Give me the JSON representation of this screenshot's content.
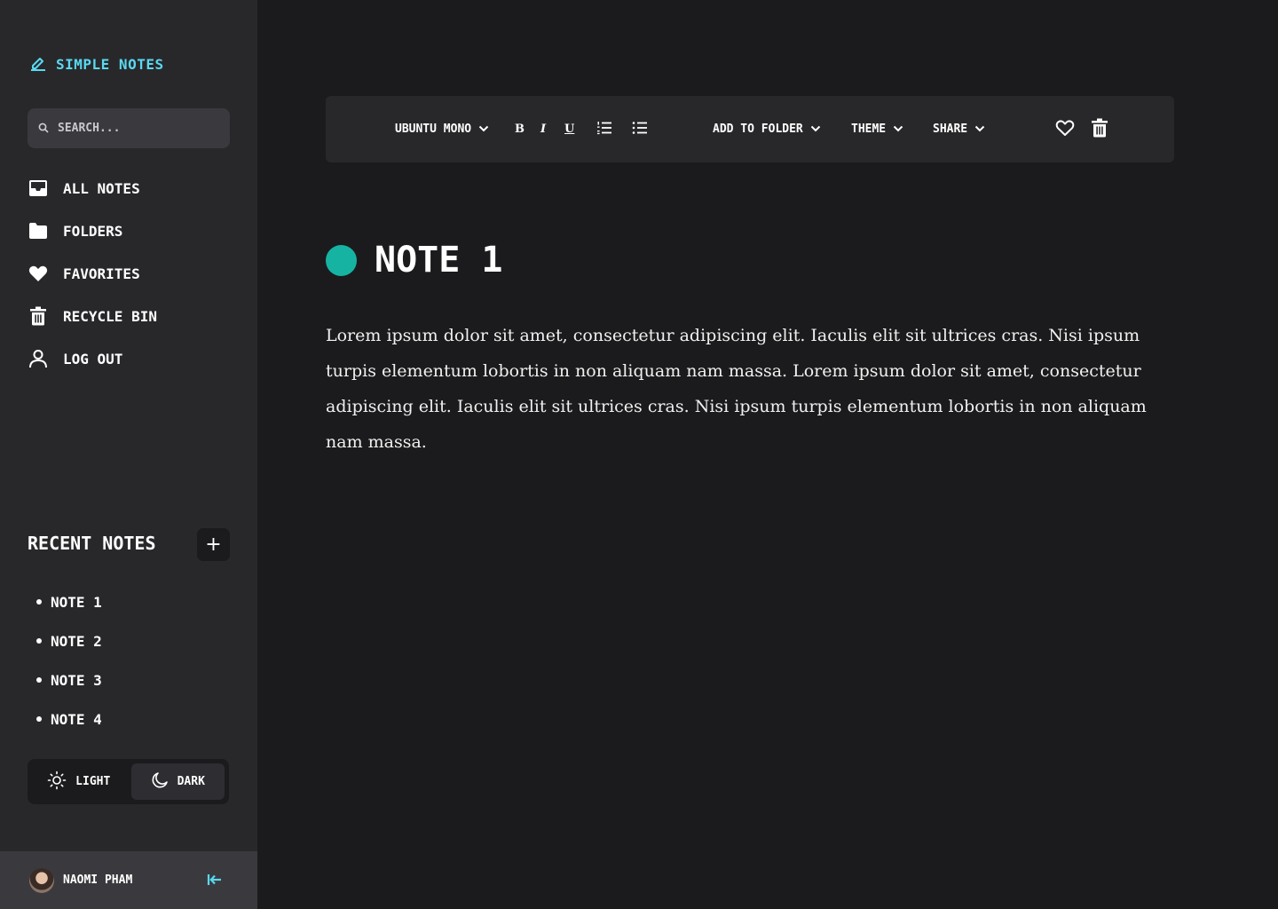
{
  "app": {
    "title": "SIMPLE NOTES",
    "accent": "#5ad8f0"
  },
  "search": {
    "placeholder": "SEARCH..."
  },
  "nav": {
    "items": [
      {
        "label": "ALL NOTES",
        "icon": "inbox-icon"
      },
      {
        "label": "FOLDERS",
        "icon": "folder-icon"
      },
      {
        "label": "FAVORITES",
        "icon": "heart-icon"
      },
      {
        "label": "RECYCLE BIN",
        "icon": "trash-icon"
      },
      {
        "label": "LOG OUT",
        "icon": "user-icon"
      }
    ]
  },
  "recent": {
    "title": "RECENT NOTES",
    "add_label": "+",
    "items": [
      "NOTE 1",
      "NOTE 2",
      "NOTE 3",
      "NOTE 4"
    ]
  },
  "theme": {
    "light": "LIGHT",
    "dark": "DARK",
    "selected": "DARK"
  },
  "user": {
    "name": "NAOMI PHAM"
  },
  "toolbar": {
    "font": "UBUNTU MONO",
    "bold": "B",
    "italic": "I",
    "underline": "U",
    "add_to_folder": "ADD TO FOLDER",
    "theme": "THEME",
    "share": "SHARE"
  },
  "note": {
    "title": "NOTE 1",
    "color": "#16b3a3",
    "body": "Lorem ipsum dolor sit amet, consectetur adipiscing elit. Iaculis elit sit ultrices cras. Nisi ipsum turpis elementum lobortis in non aliquam nam massa. Lorem ipsum dolor sit amet, consectetur adipiscing elit. Iaculis elit sit ultrices cras. Nisi ipsum turpis elementum lobortis in non aliquam nam massa."
  }
}
